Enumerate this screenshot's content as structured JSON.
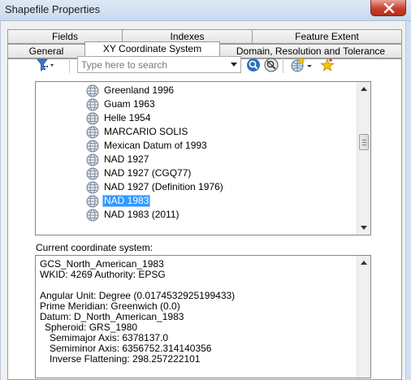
{
  "window": {
    "title": "Shapefile Properties"
  },
  "tabs": {
    "row_back": [
      "Fields",
      "Indexes",
      "Feature Extent"
    ],
    "row_front": [
      "General",
      "XY Coordinate System",
      "Domain, Resolution and Tolerance"
    ],
    "active": "XY Coordinate System"
  },
  "toolbar": {
    "search_placeholder": "Type here to search",
    "icons": [
      "filter-icon",
      "search-icon",
      "clear-search-icon",
      "add-coordinate-system-icon",
      "add-to-favorites-icon"
    ]
  },
  "tree": {
    "items": [
      {
        "label": "Greenland 1996",
        "selected": false
      },
      {
        "label": "Guam 1963",
        "selected": false
      },
      {
        "label": "Helle 1954",
        "selected": false
      },
      {
        "label": "MARCARIO SOLIS",
        "selected": false
      },
      {
        "label": "Mexican Datum of 1993",
        "selected": false
      },
      {
        "label": "NAD 1927",
        "selected": false
      },
      {
        "label": "NAD 1927 (CGQ77)",
        "selected": false
      },
      {
        "label": "NAD 1927 (Definition 1976)",
        "selected": false
      },
      {
        "label": "NAD 1983",
        "selected": true
      },
      {
        "label": "NAD 1983 (2011)",
        "selected": false
      }
    ]
  },
  "current": {
    "label": "Current coordinate system:",
    "lines": [
      "GCS_North_American_1983",
      "WKID: 4269 Authority: EPSG",
      "",
      "Angular Unit: Degree (0.0174532925199433)",
      "Prime Meridian: Greenwich (0.0)",
      "Datum: D_North_American_1983",
      "  Spheroid: GRS_1980",
      "    Semimajor Axis: 6378137.0",
      "    Semiminor Axis: 6356752.314140356",
      "    Inverse Flattening: 298.257222101"
    ]
  }
}
